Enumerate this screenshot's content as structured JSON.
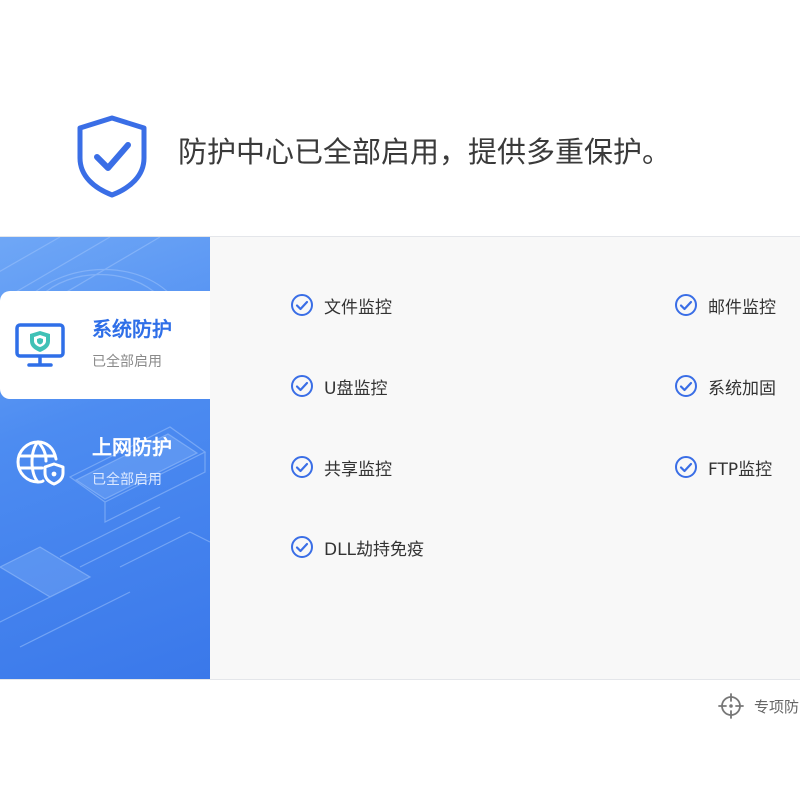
{
  "header": {
    "title": "防护中心已全部启用，提供多重保护。",
    "icon": "shield-check-icon"
  },
  "sidebar": {
    "items": [
      {
        "title": "系统防护",
        "status": "已全部启用",
        "icon": "monitor-shield-icon",
        "active": true
      },
      {
        "title": "上网防护",
        "status": "已全部启用",
        "icon": "globe-shield-icon",
        "active": false
      }
    ]
  },
  "features": [
    {
      "label": "文件监控",
      "icon": "check-circle-icon"
    },
    {
      "label": "邮件监控",
      "icon": "check-circle-icon"
    },
    {
      "label": "U盘监控",
      "icon": "check-circle-icon"
    },
    {
      "label": "系统加固",
      "icon": "check-circle-icon"
    },
    {
      "label": "共享监控",
      "icon": "check-circle-icon"
    },
    {
      "label": "FTP监控",
      "icon": "check-circle-icon"
    },
    {
      "label": "DLL劫持免疫",
      "icon": "check-circle-icon"
    }
  ],
  "footer": {
    "link_label": "专项防",
    "icon": "crosshair-icon"
  },
  "colors": {
    "accent": "#3a6ee6",
    "sidebar_gradient_start": "#6fa7f6",
    "sidebar_gradient_end": "#3a78ea",
    "panel_bg": "#f8f8f8"
  }
}
